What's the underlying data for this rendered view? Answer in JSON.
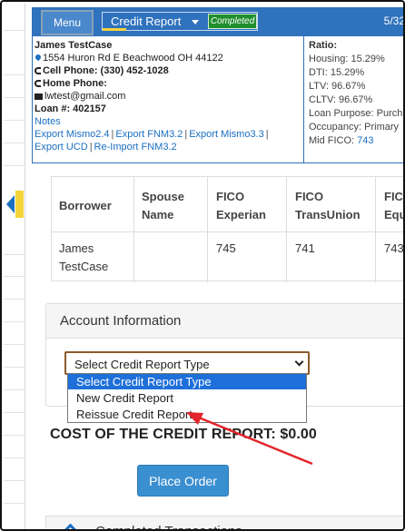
{
  "topbar": {
    "menu_label": "Menu",
    "tab_title": "Credit Report",
    "tab_badge": "Completed",
    "date_partial": "5/32"
  },
  "borrower_info": {
    "name": "James TestCase",
    "address": "1554 Huron Rd E Beachwood OH 44122",
    "cell_phone": "Cell Phone: (330) 452-1028",
    "home_phone": "Home Phone:",
    "email": "lwtest@gmail.com",
    "loan_number": "Loan #: 402157",
    "notes_link": "Notes",
    "links_row1": [
      "Export Mismo2.4",
      "Export FNM3.2",
      "Export Mismo3.3"
    ],
    "links_row2": [
      "Export UCD",
      "Re-Import FNM3.2"
    ]
  },
  "ratios": {
    "heading": "Ratio:",
    "housing": "Housing: 15.29%",
    "dti": "DTI: 15.29%",
    "ltv": "LTV: 96.67%",
    "cltv": "CLTV: 96.67%",
    "loan_purpose": "Loan Purpose: Purch",
    "occupancy": "Occupancy: Primary",
    "mid_fico_label": "Mid FICO:",
    "mid_fico_value": "743"
  },
  "score_table": {
    "headers": [
      "Borrower",
      "Spouse Name",
      "FICO Experian",
      "FICO TransUnion",
      "FICO Equ"
    ],
    "header_lines": [
      [
        "Borrower"
      ],
      [
        "Spouse",
        "Name"
      ],
      [
        "FICO",
        "Experian"
      ],
      [
        "FICO",
        "TransUnion"
      ],
      [
        "FIC",
        "Equ"
      ]
    ],
    "row": {
      "borrower_lines": [
        "James",
        "TestCase"
      ],
      "spouse": "",
      "experian": "745",
      "transunion": "741",
      "equifax": "743"
    }
  },
  "account": {
    "title": "Account Information",
    "select_value": "Select Credit Report Type",
    "options": [
      "Select Credit Report Type",
      "New Credit Report",
      "Reissue Credit Report"
    ],
    "selected_option": "Select Credit Report Type"
  },
  "cost_text": "COST OF THE CREDIT REPORT: $0.00",
  "place_order_label": "Place Order",
  "bottom_panel_title": "Completed Transactions",
  "colors": {
    "primary_blue": "#2f72bd",
    "badge_green": "#1f8f2d",
    "button_blue": "#3a8fd0",
    "annotation_red": "#e3262b",
    "dropdown_highlight": "#1e6fd9"
  },
  "icons": {
    "address": "map-pin-icon",
    "phone": "phone-icon",
    "email": "envelope-icon",
    "collapse": "chevron-up-icon",
    "dropdown": "chevron-down-icon"
  }
}
